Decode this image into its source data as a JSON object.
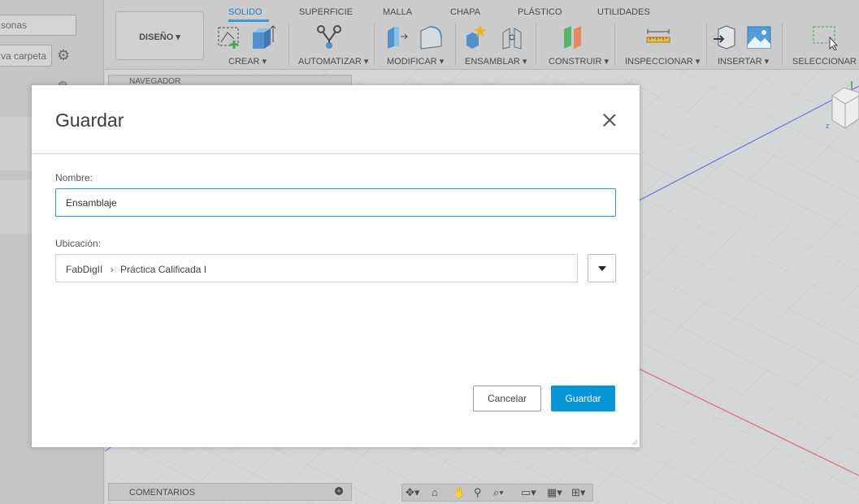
{
  "left_panel": {
    "search_placeholder_fragment": "sonas",
    "new_folder_label_fragment": "va carpeta",
    "settings_icon": "gear-icon",
    "globe_icon": "globe-icon"
  },
  "toolbar": {
    "workspace_label": "DISEÑO ▾",
    "tabs": [
      "SOLIDO",
      "SUPERFICIE",
      "MALLA",
      "CHAPA",
      "PLÁSTICO",
      "UTILIDADES"
    ],
    "active_tab": "SOLIDO",
    "groups": [
      "CREAR ▾",
      "AUTOMATIZAR ▾",
      "MODIFICAR ▾",
      "ENSAMBLAR ▾",
      "CONSTRUIR ▾",
      "INSPECCIONAR ▾",
      "INSERTAR ▾",
      "SELECCIONAR ▾"
    ]
  },
  "browser": {
    "navigator_label": "NAVEGADOR",
    "comments_label": "COMENTARIOS"
  },
  "dialog": {
    "title": "Guardar",
    "name_label": "Nombre:",
    "name_value": "Ensamblaje",
    "location_label": "Ubicación:",
    "location_project": "FabDigII",
    "location_separator": "›",
    "location_folder": "Práctica Calificada I",
    "cancel_label": "Cancelar",
    "save_label": "Guardar"
  },
  "colors": {
    "accent": "#0696d7",
    "focus_border": "#2a9bd6",
    "active_tab": "#0a6fb5"
  }
}
